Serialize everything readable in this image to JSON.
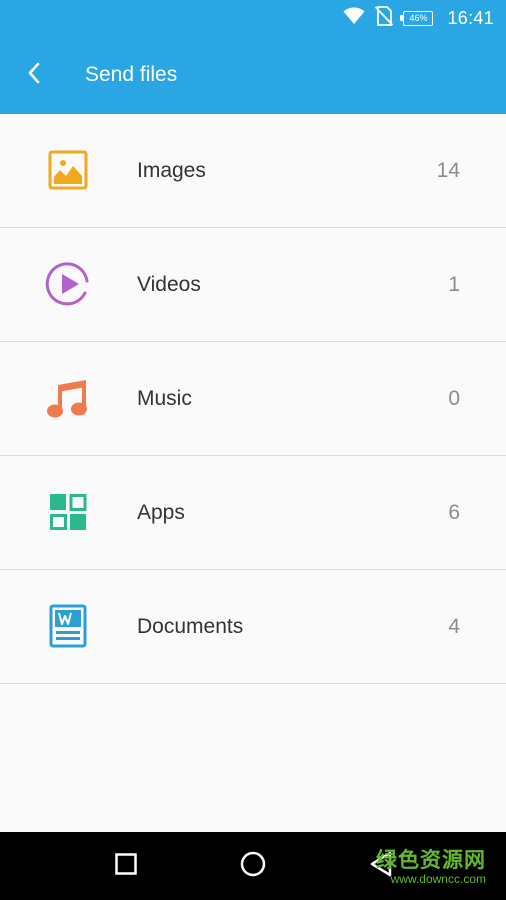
{
  "status_bar": {
    "battery_level": "46%",
    "time": "16:41"
  },
  "header": {
    "title": "Send files",
    "back_icon": "chevron-left-icon"
  },
  "categories": [
    {
      "label": "Images",
      "count": "14",
      "icon": "image-icon",
      "color": "#f0a91e"
    },
    {
      "label": "Videos",
      "count": "1",
      "icon": "play-circle-icon",
      "color": "#b260cc"
    },
    {
      "label": "Music",
      "count": "0",
      "icon": "music-note-icon",
      "color": "#ef7a4e"
    },
    {
      "label": "Apps",
      "count": "6",
      "icon": "apps-grid-icon",
      "color": "#2ab88c"
    },
    {
      "label": "Documents",
      "count": "4",
      "icon": "word-document-icon",
      "color": "#2e9fd6"
    }
  ],
  "nav_bar": {
    "recents_icon": "square-icon",
    "home_icon": "circle-icon",
    "back_icon": "triangle-back-icon"
  },
  "watermark": {
    "main": "绿色资源网",
    "sub": "www.downcc.com"
  },
  "colors": {
    "accent": "#2aa6e4",
    "background": "#fafafa",
    "divider": "#dcdcdc"
  }
}
